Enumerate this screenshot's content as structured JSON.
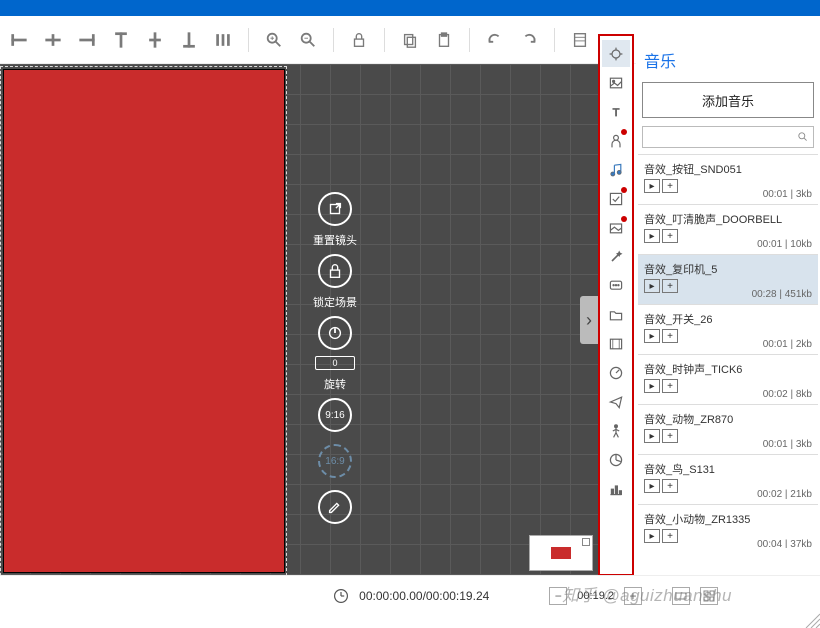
{
  "canvas": {
    "reset_cam_label": "重置镜头",
    "lock_scene_label": "锁定场景",
    "rotate_label": "旋转",
    "rotate_value": "0",
    "ratio_916": "9:16",
    "ratio_169": "16:9"
  },
  "panel": {
    "title": "音乐",
    "add_button": "添加音乐"
  },
  "music": [
    {
      "name": "音效_按钮_SND051",
      "meta": "00:01 | 3kb",
      "selected": false
    },
    {
      "name": "音效_叮清脆声_DOORBELL",
      "meta": "00:01 | 10kb",
      "selected": false
    },
    {
      "name": "音效_复印机_5",
      "meta": "00:28 | 451kb",
      "selected": true
    },
    {
      "name": "音效_开关_26",
      "meta": "00:01 | 2kb",
      "selected": false
    },
    {
      "name": "音效_时钟声_TICK6",
      "meta": "00:02 | 8kb",
      "selected": false
    },
    {
      "name": "音效_动物_ZR870",
      "meta": "00:01 | 3kb",
      "selected": false
    },
    {
      "name": "音效_鸟_S131",
      "meta": "00:02 | 21kb",
      "selected": false
    },
    {
      "name": "音效_小动物_ZR1335",
      "meta": "00:04 | 37kb",
      "selected": false
    }
  ],
  "status": {
    "time": "00:00:00.00/00:00:19.24",
    "zoom": "00:19.2"
  },
  "watermark": "知乎 @aguizhuanshu",
  "side_tools": [
    {
      "name": "pointer-icon",
      "sel": true,
      "dot": false
    },
    {
      "name": "image-icon",
      "sel": false,
      "dot": false
    },
    {
      "name": "text-icon",
      "sel": false,
      "dot": false
    },
    {
      "name": "person-icon",
      "sel": false,
      "dot": true
    },
    {
      "name": "music-icon",
      "sel": false,
      "dot": false
    },
    {
      "name": "effects-icon",
      "sel": false,
      "dot": true
    },
    {
      "name": "photo-icon",
      "sel": false,
      "dot": true
    },
    {
      "name": "magic-icon",
      "sel": false,
      "dot": false
    },
    {
      "name": "chat-icon",
      "sel": false,
      "dot": false
    },
    {
      "name": "folder-icon",
      "sel": false,
      "dot": false
    },
    {
      "name": "film-icon",
      "sel": false,
      "dot": false
    },
    {
      "name": "gauge-icon",
      "sel": false,
      "dot": false
    },
    {
      "name": "plane-icon",
      "sel": false,
      "dot": false
    },
    {
      "name": "walk-icon",
      "sel": false,
      "dot": false
    },
    {
      "name": "pie-icon",
      "sel": false,
      "dot": false
    },
    {
      "name": "chart-icon",
      "sel": false,
      "dot": false
    }
  ]
}
